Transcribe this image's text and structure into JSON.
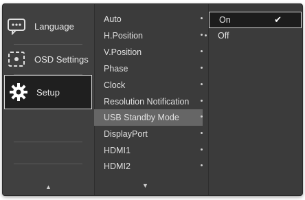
{
  "main_menu": [
    {
      "label": "Language",
      "icon": "language-icon"
    },
    {
      "label": "OSD Settings",
      "icon": "osd-settings-icon"
    },
    {
      "label": "Setup",
      "icon": "gear-icon"
    }
  ],
  "submenu": [
    "Auto",
    "H.Position",
    "V.Position",
    "Phase",
    "Clock",
    "Resolution Notification",
    "USB Standby Mode",
    "DisplayPort",
    "HDMI1",
    "HDMI2"
  ],
  "options": [
    {
      "label": "On",
      "selected": true
    },
    {
      "label": "Off",
      "selected": false
    }
  ],
  "navigation": {
    "up_arrow": "▲",
    "down_arrow": "▼",
    "check": "✔"
  }
}
